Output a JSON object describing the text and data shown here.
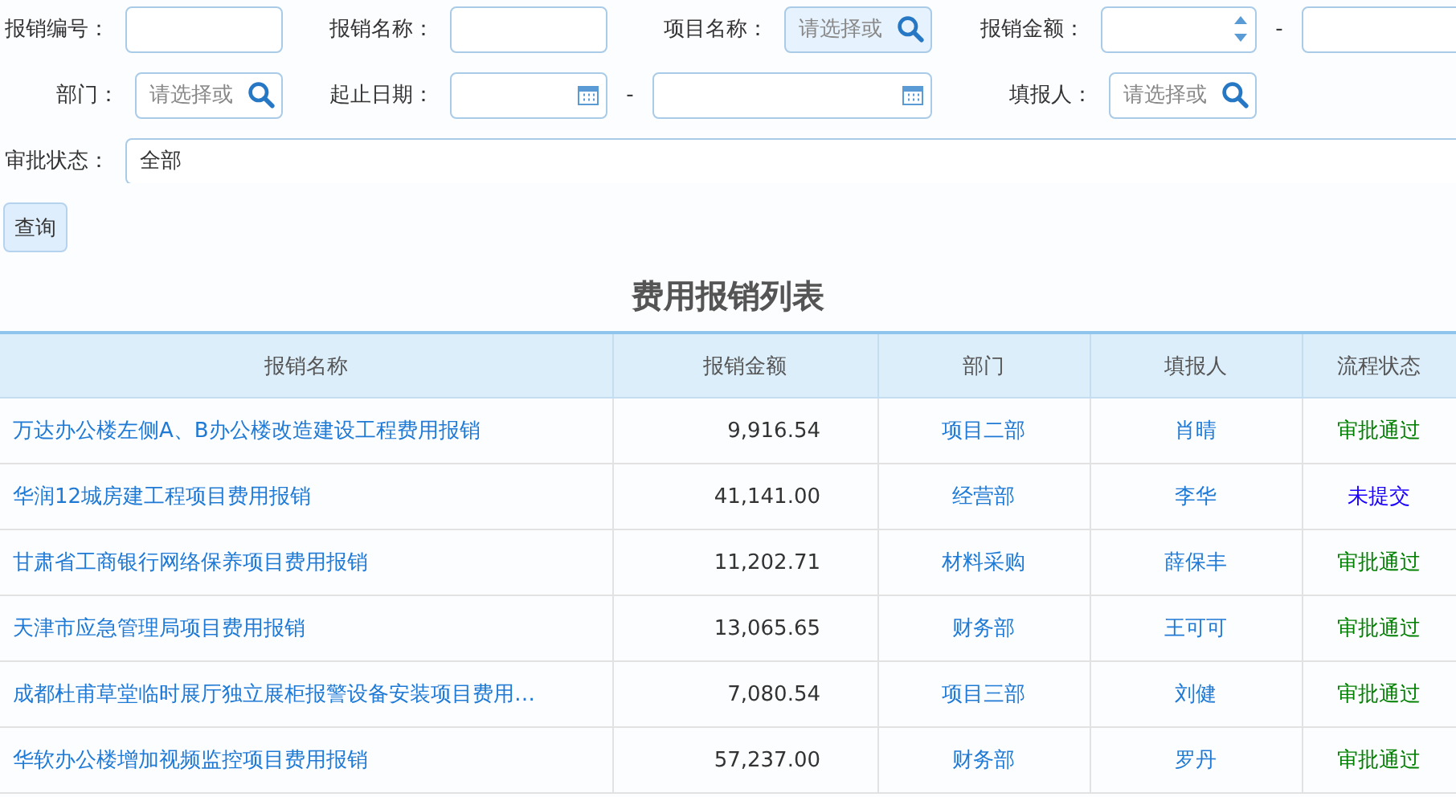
{
  "filter_rows": [
    [
      {
        "label": "报销编号：",
        "kind": "text",
        "disabled": false
      },
      {
        "label": "报销名称：",
        "kind": "text",
        "disabled": false
      },
      {
        "label": "项目名称：",
        "kind": "lookup",
        "placeholder": "请选择或",
        "disabled": true
      },
      {
        "label": "报销金额：",
        "kind": "number_range",
        "separator": "-",
        "disabled": false
      }
    ],
    [
      {
        "label": "部门：",
        "kind": "lookup",
        "placeholder": "请选择或",
        "disabled": false
      },
      {
        "label": "起止日期：",
        "kind": "date_range",
        "separator": "-",
        "disabled": false
      },
      {
        "label": "填报人：",
        "kind": "lookup",
        "placeholder": "请选择或",
        "disabled": false
      }
    ],
    [
      {
        "label": "审批状态：",
        "kind": "select",
        "value": "全部",
        "disabled": false
      }
    ]
  ],
  "query_button": "查询",
  "table": {
    "title": "费用报销列表",
    "columns": [
      "报销名称",
      "报销金额",
      "部门",
      "填报人",
      "流程状态"
    ],
    "rows": [
      {
        "name": "万达办公楼左侧A、B办公楼改造建设工程费用报销",
        "amount": "9,916.54",
        "department": "项目二部",
        "reporter": "肖晴",
        "status": "审批通过",
        "color": "#008000"
      },
      {
        "name": "华润12城房建工程项目费用报销",
        "amount": "41,141.00",
        "department": "经营部",
        "reporter": "李华",
        "status": "未提交",
        "color": "#1a00ff"
      },
      {
        "name": "甘肃省工商银行网络保养项目费用报销",
        "amount": "11,202.71",
        "department": "材料采购",
        "reporter": "薛保丰",
        "status": "审批通过",
        "color": "#008000"
      },
      {
        "name": "天津市应急管理局项目费用报销",
        "amount": "13,065.65",
        "department": "财务部",
        "reporter": "王可可",
        "status": "审批通过",
        "color": "#008000"
      },
      {
        "name": "成都杜甫草堂临时展厅独立展柜报警设备安装项目费用…",
        "amount": "7,080.54",
        "department": "项目三部",
        "reporter": "刘健",
        "status": "审批通过",
        "color": "#008000"
      },
      {
        "name": "华软办公楼增加视频监控项目费用报销",
        "amount": "57,237.00",
        "department": "财务部",
        "reporter": "罗丹",
        "status": "审批通过",
        "color": "#008000"
      }
    ]
  }
}
